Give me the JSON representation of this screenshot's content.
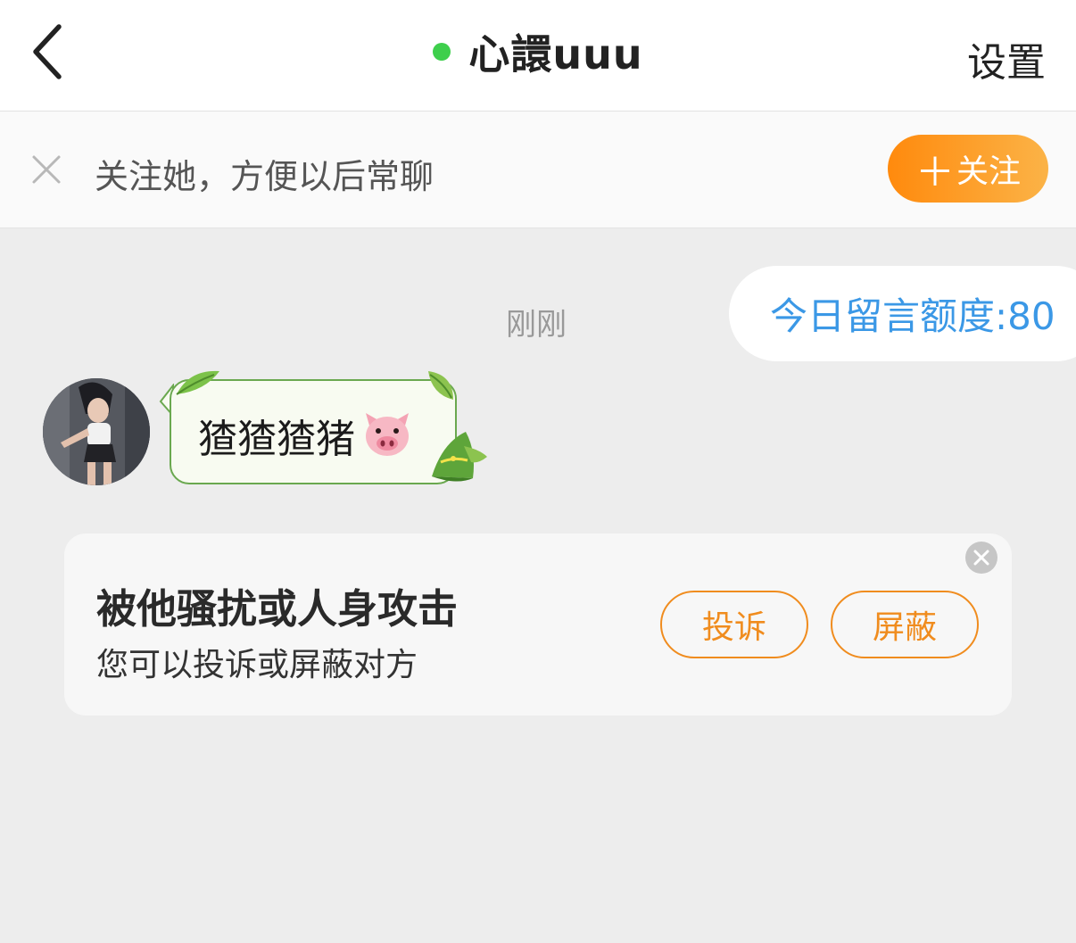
{
  "header": {
    "title": "心譞uuu",
    "online_color": "#3ecf4c",
    "settings_label": "设置",
    "back_icon": "chevron-left-icon"
  },
  "follow_bar": {
    "text": "关注她，方便以后常聊",
    "button_plus": "＋",
    "button_label": "关注",
    "accent": "#ff8a0d"
  },
  "quota": {
    "text": "今日留言额度:80",
    "color": "#3b98e6"
  },
  "chat": {
    "timestamp": "刚刚",
    "messages": [
      {
        "sender": "other",
        "text": "猹猹猹猪",
        "emoji": "pig-face-icon"
      }
    ]
  },
  "warning_card": {
    "title": "被他骚扰或人身攻击",
    "subtitle": "您可以投诉或屏蔽对方",
    "complain_label": "投诉",
    "block_label": "屏蔽",
    "accent": "#f08c1e"
  }
}
